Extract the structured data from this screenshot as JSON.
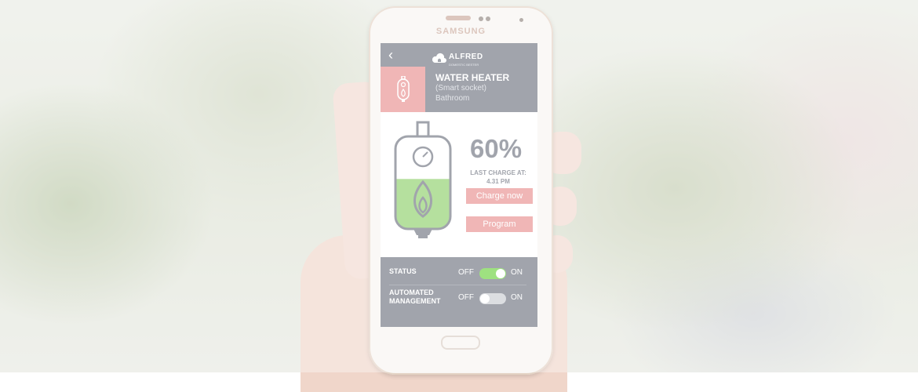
{
  "phone": {
    "brand": "SAMSUNG"
  },
  "app": {
    "back_icon": "chevron-left-icon",
    "logo_icon": "house-cloud-icon",
    "logo_text": "ALFRED",
    "logo_subtext": "DOMESTIC BESTER"
  },
  "device": {
    "icon": "water-heater-icon",
    "title": "WATER HEATER",
    "type": "(Smart socket)",
    "room": "Bathroom"
  },
  "charge": {
    "level_percent": 60,
    "percent_text": "60%",
    "last_charge_label": "LAST CHARGE AT:",
    "last_charge_time": "4.31 PM",
    "charge_button": "Charge now",
    "program_button": "Program"
  },
  "controls": [
    {
      "label": "STATUS",
      "off": "OFF",
      "on": "ON",
      "state": "on"
    },
    {
      "label_line1": "AUTOMATED",
      "label_line2": "MANAGEMENT",
      "off": "OFF",
      "on": "ON",
      "state": "off"
    }
  ],
  "colors": {
    "header_gray": "#6f7480",
    "accent_pink": "#e89090",
    "fill_green": "#8ed06a",
    "toggle_on": "#6ad23c",
    "toggle_off": "#c9ccd2"
  }
}
